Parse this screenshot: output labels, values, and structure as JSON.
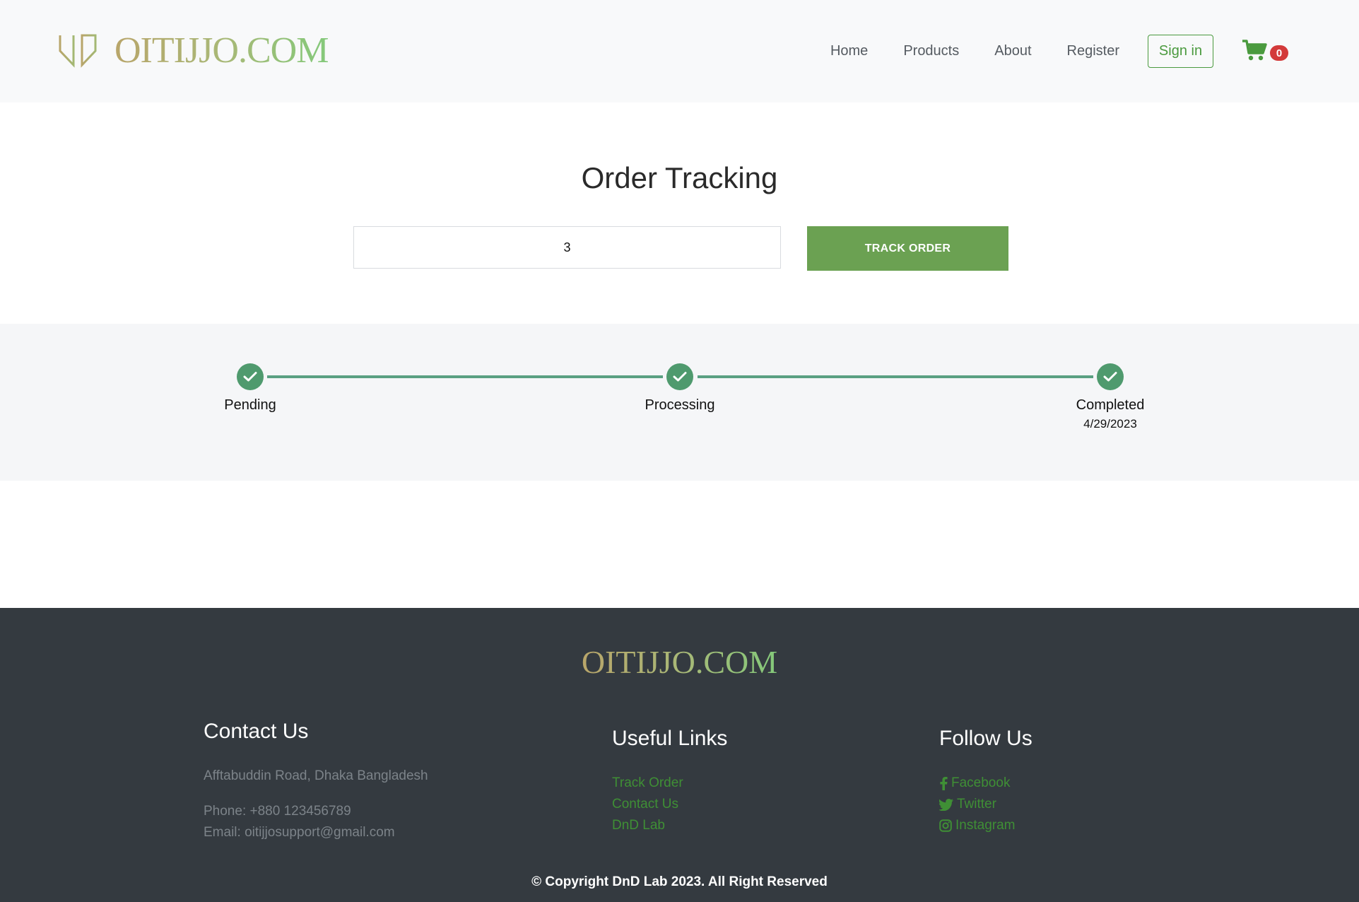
{
  "brand": {
    "name": "OITIJJO.COM"
  },
  "nav": {
    "items": [
      {
        "label": "Home"
      },
      {
        "label": "Products"
      },
      {
        "label": "About"
      },
      {
        "label": "Register"
      }
    ],
    "signin_label": "Sign in",
    "cart_count": "0"
  },
  "tracking": {
    "title": "Order Tracking",
    "order_value": "3",
    "button_label": "TRACK ORDER",
    "steps": [
      {
        "label": "Pending",
        "date": "",
        "completed": true
      },
      {
        "label": "Processing",
        "date": "",
        "completed": true
      },
      {
        "label": "Completed",
        "date": "4/29/2023",
        "completed": true
      }
    ]
  },
  "footer": {
    "brand": "OITIJJO.COM",
    "contact": {
      "heading": "Contact Us",
      "address": "Afftabuddin Road, Dhaka Bangladesh",
      "phone": "Phone: +880 123456789",
      "email": "Email: oitijjosupport@gmail.com"
    },
    "links": {
      "heading": "Useful Links",
      "items": [
        {
          "label": "Track Order"
        },
        {
          "label": "Contact Us"
        },
        {
          "label": "DnD Lab"
        }
      ]
    },
    "social": {
      "heading": "Follow Us",
      "items": [
        {
          "label": "Facebook",
          "icon": "facebook-icon"
        },
        {
          "label": "Twitter",
          "icon": "twitter-icon"
        },
        {
          "label": "Instagram",
          "icon": "instagram-icon"
        }
      ]
    },
    "copyright": "© Copyright DnD Lab 2023. All Right Reserved"
  },
  "colors": {
    "accent_green": "#6ba152",
    "link_green": "#3f8f35",
    "step_green": "#4f9a6e",
    "badge_red": "#d33a3a",
    "footer_bg": "#343a40"
  }
}
